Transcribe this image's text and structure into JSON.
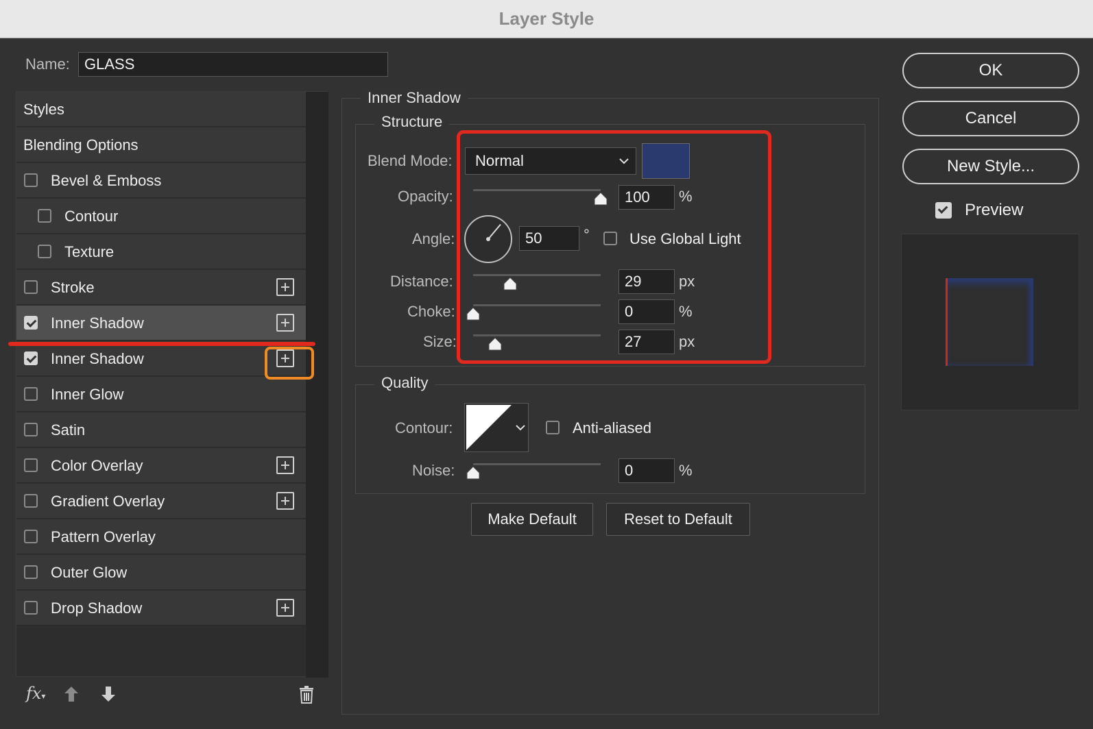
{
  "window": {
    "title": "Layer Style"
  },
  "name_field": {
    "label": "Name:",
    "value": "GLASS"
  },
  "styles_list": {
    "items": [
      {
        "label": "Styles",
        "has_checkbox": false,
        "checked": false,
        "indent": false,
        "has_add": false,
        "selected": false
      },
      {
        "label": "Blending Options",
        "has_checkbox": false,
        "checked": false,
        "indent": false,
        "has_add": false,
        "selected": false
      },
      {
        "label": "Bevel & Emboss",
        "has_checkbox": true,
        "checked": false,
        "indent": false,
        "has_add": false,
        "selected": false
      },
      {
        "label": "Contour",
        "has_checkbox": true,
        "checked": false,
        "indent": true,
        "has_add": false,
        "selected": false
      },
      {
        "label": "Texture",
        "has_checkbox": true,
        "checked": false,
        "indent": true,
        "has_add": false,
        "selected": false
      },
      {
        "label": "Stroke",
        "has_checkbox": true,
        "checked": false,
        "indent": false,
        "has_add": true,
        "selected": false
      },
      {
        "label": "Inner Shadow",
        "has_checkbox": true,
        "checked": true,
        "indent": false,
        "has_add": true,
        "selected": true
      },
      {
        "label": "Inner Shadow",
        "has_checkbox": true,
        "checked": true,
        "indent": false,
        "has_add": true,
        "selected": false
      },
      {
        "label": "Inner Glow",
        "has_checkbox": true,
        "checked": false,
        "indent": false,
        "has_add": false,
        "selected": false
      },
      {
        "label": "Satin",
        "has_checkbox": true,
        "checked": false,
        "indent": false,
        "has_add": false,
        "selected": false
      },
      {
        "label": "Color Overlay",
        "has_checkbox": true,
        "checked": false,
        "indent": false,
        "has_add": true,
        "selected": false
      },
      {
        "label": "Gradient Overlay",
        "has_checkbox": true,
        "checked": false,
        "indent": false,
        "has_add": true,
        "selected": false
      },
      {
        "label": "Pattern Overlay",
        "has_checkbox": true,
        "checked": false,
        "indent": false,
        "has_add": false,
        "selected": false
      },
      {
        "label": "Outer Glow",
        "has_checkbox": true,
        "checked": false,
        "indent": false,
        "has_add": false,
        "selected": false
      },
      {
        "label": "Drop Shadow",
        "has_checkbox": true,
        "checked": false,
        "indent": false,
        "has_add": true,
        "selected": false
      }
    ],
    "toolbar": {
      "fx_label": "fx",
      "icons": [
        "fx-icon",
        "arrow-up-icon",
        "arrow-down-icon",
        "trash-icon"
      ]
    }
  },
  "inner_shadow": {
    "section_title": "Inner Shadow",
    "structure": {
      "title": "Structure",
      "blend_mode": {
        "label": "Blend Mode:",
        "value": "Normal",
        "color": "#2b3a6e"
      },
      "opacity": {
        "label": "Opacity:",
        "value": "100",
        "unit": "%",
        "fraction": 1.0
      },
      "angle": {
        "label": "Angle:",
        "value": "50",
        "unit": "°",
        "degrees": 50,
        "global_light_label": "Use Global Light",
        "global_light_checked": false
      },
      "distance": {
        "label": "Distance:",
        "value": "29",
        "unit": "px",
        "fraction": 0.29
      },
      "choke": {
        "label": "Choke:",
        "value": "0",
        "unit": "%",
        "fraction": 0.0
      },
      "size": {
        "label": "Size:",
        "value": "27",
        "unit": "px",
        "fraction": 0.17
      }
    },
    "quality": {
      "title": "Quality",
      "contour": {
        "label": "Contour:",
        "anti_aliased_label": "Anti-aliased",
        "anti_aliased_checked": false
      },
      "noise": {
        "label": "Noise:",
        "value": "0",
        "unit": "%",
        "fraction": 0.0
      }
    },
    "buttons": {
      "make_default": "Make Default",
      "reset_default": "Reset to Default"
    }
  },
  "actions": {
    "ok": "OK",
    "cancel": "Cancel",
    "new_style": "New Style...",
    "preview_label": "Preview",
    "preview_checked": true
  },
  "colors": {
    "annotation_red": "#e1291f",
    "annotation_orange": "#f08a24",
    "shadow_color": "#2b3a6e",
    "preview_red": "#d0262a"
  }
}
